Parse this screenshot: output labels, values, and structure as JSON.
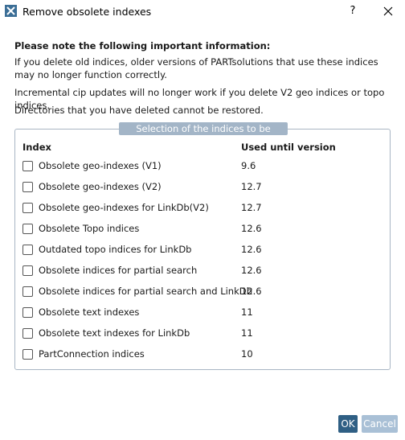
{
  "window": {
    "title": "Remove obsolete indexes",
    "help_label": "?"
  },
  "notice": {
    "heading": "Please note the following important information:",
    "line1": "If you delete old indices, older versions of PARTsolutions that use these indices may no longer function correctly.",
    "line2": "Incremental cip updates will no longer work if you delete V2 geo indices or topo indices.",
    "line3": "Directories that you have deleted cannot be restored."
  },
  "group": {
    "title": "Selection of the indices to be deleted",
    "col_index": "Index",
    "col_version": "Used until version",
    "rows": [
      {
        "label": "Obsolete geo-indexes (V1)",
        "version": "9.6",
        "checked": false
      },
      {
        "label": "Obsolete geo-indexes (V2)",
        "version": "12.7",
        "checked": false
      },
      {
        "label": "Obsolete geo-indexes for LinkDb(V2)",
        "version": "12.7",
        "checked": false
      },
      {
        "label": "Obsolete Topo indices",
        "version": "12.6",
        "checked": false
      },
      {
        "label": "Outdated topo indices for LinkDb",
        "version": "12.6",
        "checked": false
      },
      {
        "label": "Obsolete indices for partial search",
        "version": "12.6",
        "checked": false
      },
      {
        "label": "Obsolete indices for partial search and LinkDb",
        "version": "12.6",
        "checked": false
      },
      {
        "label": "Obsolete text indexes",
        "version": "11",
        "checked": false
      },
      {
        "label": "Obsolete text indexes for LinkDb",
        "version": "11",
        "checked": false
      },
      {
        "label": "PartConnection indices",
        "version": "10",
        "checked": false
      }
    ]
  },
  "buttons": {
    "ok": "OK",
    "cancel": "Cancel"
  },
  "colors": {
    "group_title_bg": "#a3b5c7",
    "ok_bg": "#2f5f84",
    "cancel_bg": "#a9c0d6"
  }
}
